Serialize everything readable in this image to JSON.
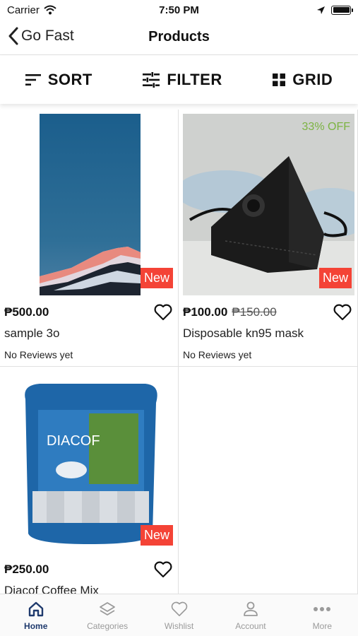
{
  "status_bar": {
    "carrier": "Carrier",
    "time": "7:50 PM"
  },
  "nav": {
    "back_label": "Go Fast",
    "title": "Products"
  },
  "toolbar": {
    "sort_label": "SORT",
    "filter_label": "FILTER",
    "grid_label": "GRID"
  },
  "products": [
    {
      "price": "₱500.00",
      "old_price": "",
      "name": "sample 3o",
      "reviews": "No Reviews yet",
      "badge": "New",
      "discount": ""
    },
    {
      "price": "₱100.00",
      "old_price": "₱150.00",
      "name": "Disposable kn95 mask",
      "reviews": "No Reviews yet",
      "badge": "New",
      "discount": "33% OFF"
    },
    {
      "price": "₱250.00",
      "old_price": "",
      "name": "Diacof Coffee Mix",
      "reviews": "",
      "badge": "New",
      "discount": ""
    }
  ],
  "product_image_text": {
    "brand": "DIACOF"
  },
  "tabbar": {
    "home": "Home",
    "categories": "Categories",
    "wishlist": "Wishlist",
    "account": "Account",
    "more": "More"
  },
  "colors": {
    "accent": "#1f3a6d",
    "badge": "#f44336",
    "discount": "#7cb342"
  },
  "icons": [
    "wifi-icon",
    "location-arrow-icon",
    "battery-icon",
    "chevron-left-icon",
    "sort-icon",
    "filter-icon",
    "grid-icon",
    "heart-outline-icon",
    "home-icon",
    "layers-icon",
    "heart-icon",
    "account-icon",
    "more-icon"
  ]
}
